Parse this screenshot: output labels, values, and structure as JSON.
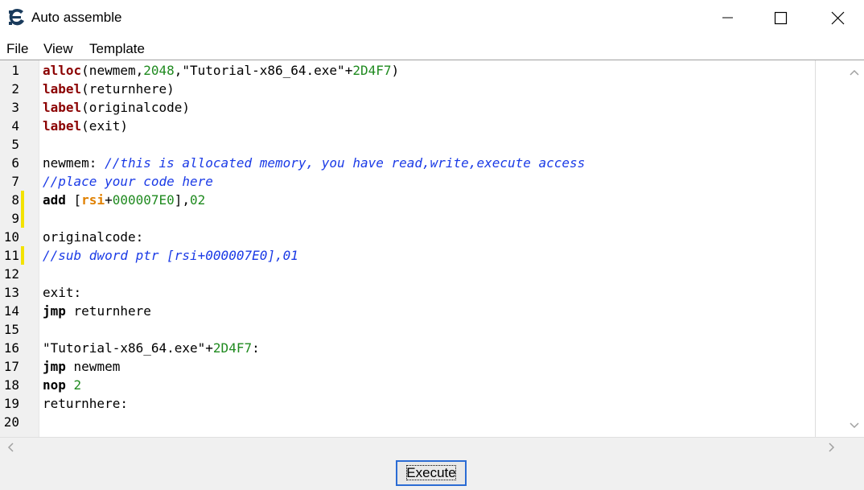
{
  "window": {
    "title": "Auto assemble"
  },
  "menu": {
    "file": "File",
    "view": "View",
    "template": "Template"
  },
  "editor": {
    "line_numbers": [
      "1",
      "2",
      "3",
      "4",
      "5",
      "6",
      "7",
      "8",
      "9",
      "10",
      "11",
      "12",
      "13",
      "14",
      "15",
      "16",
      "17",
      "18",
      "19",
      "20"
    ],
    "lines": [
      [
        {
          "t": "kw",
          "v": "alloc"
        },
        {
          "t": "p",
          "v": "(newmem,"
        },
        {
          "t": "num",
          "v": "2048"
        },
        {
          "t": "p",
          "v": ",\"Tutorial-x86_64.exe\"+"
        },
        {
          "t": "num",
          "v": "2D4F7"
        },
        {
          "t": "p",
          "v": ")"
        }
      ],
      [
        {
          "t": "kw",
          "v": "label"
        },
        {
          "t": "p",
          "v": "(returnhere)"
        }
      ],
      [
        {
          "t": "kw",
          "v": "label"
        },
        {
          "t": "p",
          "v": "(originalcode)"
        }
      ],
      [
        {
          "t": "kw",
          "v": "label"
        },
        {
          "t": "p",
          "v": "(exit)"
        }
      ],
      [],
      [
        {
          "t": "p",
          "v": "newmem: "
        },
        {
          "t": "cm",
          "v": "//this is allocated memory, you have read,write,execute access"
        }
      ],
      [
        {
          "t": "cm",
          "v": "//place your code here"
        }
      ],
      [
        {
          "t": "in",
          "v": "add"
        },
        {
          "t": "p",
          "v": " ["
        },
        {
          "t": "reg",
          "v": "rsi"
        },
        {
          "t": "p",
          "v": "+"
        },
        {
          "t": "num",
          "v": "000007E0"
        },
        {
          "t": "p",
          "v": "],"
        },
        {
          "t": "num",
          "v": "02"
        }
      ],
      [],
      [
        {
          "t": "p",
          "v": "originalcode:"
        }
      ],
      [
        {
          "t": "cm",
          "v": "//sub dword ptr [rsi+000007E0],01"
        }
      ],
      [],
      [
        {
          "t": "p",
          "v": "exit:"
        }
      ],
      [
        {
          "t": "in",
          "v": "jmp"
        },
        {
          "t": "p",
          "v": " returnhere"
        }
      ],
      [],
      [
        {
          "t": "p",
          "v": "\"Tutorial-x86_64.exe\"+"
        },
        {
          "t": "num",
          "v": "2D4F7"
        },
        {
          "t": "p",
          "v": ":"
        }
      ],
      [
        {
          "t": "in",
          "v": "jmp"
        },
        {
          "t": "p",
          "v": " newmem"
        }
      ],
      [
        {
          "t": "in",
          "v": "nop"
        },
        {
          "t": "p",
          "v": " "
        },
        {
          "t": "num",
          "v": "2"
        }
      ],
      [
        {
          "t": "p",
          "v": "returnhere:"
        }
      ],
      []
    ],
    "marked_lines": [
      8,
      9,
      11
    ]
  },
  "footer": {
    "execute_label": "Execute"
  },
  "colors": {
    "keyword": "#8b0000",
    "number": "#1f8a1f",
    "register": "#e08000",
    "comment": "#1a3ae6",
    "change_marker": "#f3e200",
    "button_focus": "#2b6cd4"
  },
  "icons": {
    "app": "cheat-engine-icon",
    "minimize": "minimize-icon",
    "maximize": "maximize-icon",
    "close": "close-icon",
    "scroll_up": "chevron-up-icon",
    "scroll_down": "chevron-down-icon",
    "scroll_left": "chevron-left-icon",
    "scroll_right": "chevron-right-icon"
  }
}
